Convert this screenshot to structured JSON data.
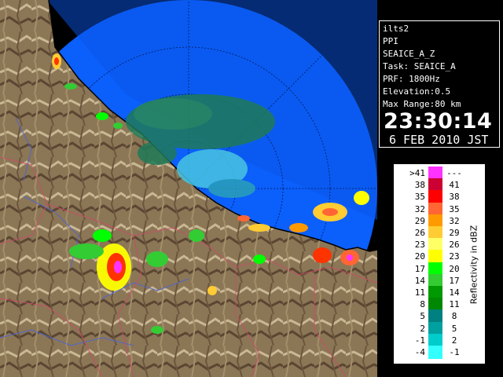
{
  "info": {
    "lines": [
      "ilts2",
      "PPI",
      "SEAICE_A_Z",
      "Task: SEAICE_A",
      "PRF: 1800Hz",
      "Elevation:0.5",
      "Max Range:80 km"
    ],
    "time": "23:30:14",
    "date": "6 FEB 2010 JST"
  },
  "legend": {
    "title": "Reflectivity in dBZ",
    "rows": [
      {
        "left": ">41",
        "right": "---",
        "color": "#ff33ff"
      },
      {
        "left": "38",
        "right": "41",
        "color": "#cc0033"
      },
      {
        "left": "35",
        "right": "38",
        "color": "#ff0000"
      },
      {
        "left": "32",
        "right": "35",
        "color": "#ff6633"
      },
      {
        "left": "29",
        "right": "32",
        "color": "#ff9900"
      },
      {
        "left": "26",
        "right": "29",
        "color": "#ffcc33"
      },
      {
        "left": "23",
        "right": "26",
        "color": "#ffff66"
      },
      {
        "left": "20",
        "right": "23",
        "color": "#ffff00"
      },
      {
        "left": "17",
        "right": "20",
        "color": "#00ff00"
      },
      {
        "left": "14",
        "right": "17",
        "color": "#33cc33"
      },
      {
        "left": "11",
        "right": "14",
        "color": "#009900"
      },
      {
        "left": "8",
        "right": "11",
        "color": "#008800"
      },
      {
        "left": "5",
        "right": "8",
        "color": "#008080"
      },
      {
        "left": "2",
        "right": "5",
        "color": "#00a0a0"
      },
      {
        "left": "-1",
        "right": "2",
        "color": "#00cccc"
      },
      {
        "left": "-4",
        "right": "-1",
        "color": "#33ffff"
      }
    ]
  },
  "colors": {
    "sea": "#0b5ffb",
    "sea_outer": "#3d87fb",
    "land": "#8a7555",
    "coast": "#000000"
  }
}
